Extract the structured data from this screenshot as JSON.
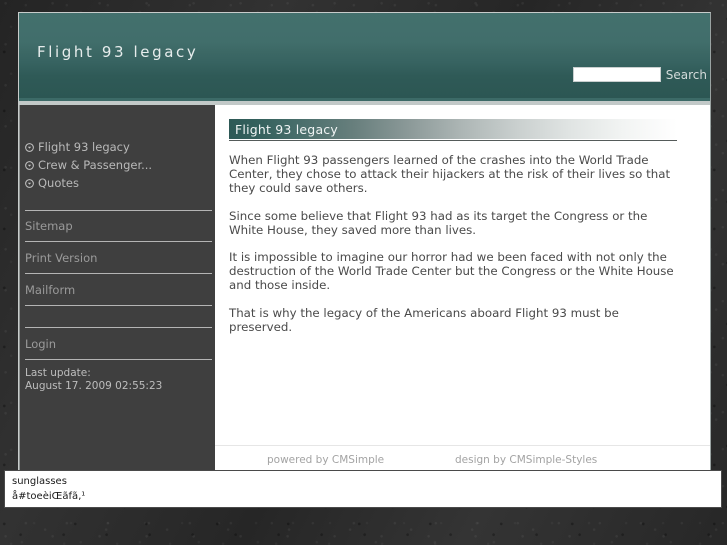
{
  "site": {
    "title": "Flight 93 legacy"
  },
  "search": {
    "value": "",
    "placeholder": "",
    "button_label": "Search"
  },
  "sidebar": {
    "nav_items": [
      {
        "label": "Flight 93 legacy",
        "icon": "circled-arrow-icon"
      },
      {
        "label": "Crew & Passenger...",
        "icon": "circled-arrow-icon"
      },
      {
        "label": "Quotes",
        "icon": "circled-arrow-icon"
      }
    ],
    "utility_items": [
      {
        "label": "Sitemap"
      },
      {
        "label": "Print Version"
      },
      {
        "label": "Mailform"
      },
      {
        "label": ""
      },
      {
        "label": "Login"
      }
    ],
    "last_update_label": "Last update:",
    "last_update_value": "August 17. 2009 02:55:23"
  },
  "content": {
    "heading": "Flight 93 legacy",
    "paragraphs": [
      "When Flight 93 passengers learned of the crashes into the World Trade Center, they chose to attack their hijackers at the risk of their lives so that they could save others.",
      "Since some believe that Flight 93 had as its target the Congress or the White House, they saved more than lives.",
      "It is impossible to imagine our horror had we been faced with not only the destruction of the World Trade Center but the Congress or the White House and those inside.",
      "That is why the legacy of the Americans aboard Flight 93 must be preserved."
    ]
  },
  "footer": {
    "powered_by": "powered by CMSimple",
    "design_by": "design by CMSimple-Styles"
  },
  "suggestion_panel": {
    "rows": [
      "sunglasses",
      "å#toeèiŒãfã‚¹"
    ]
  },
  "colors": {
    "header_top": "#43706d",
    "header_bottom": "#2c5653",
    "heading_bar_start": "#2e5956",
    "heading_bar_end": "#ffffff",
    "sidebar_bg": "#3f3f3f",
    "content_bg": "#ffffff",
    "page_backdrop": "#2b2b2b"
  }
}
